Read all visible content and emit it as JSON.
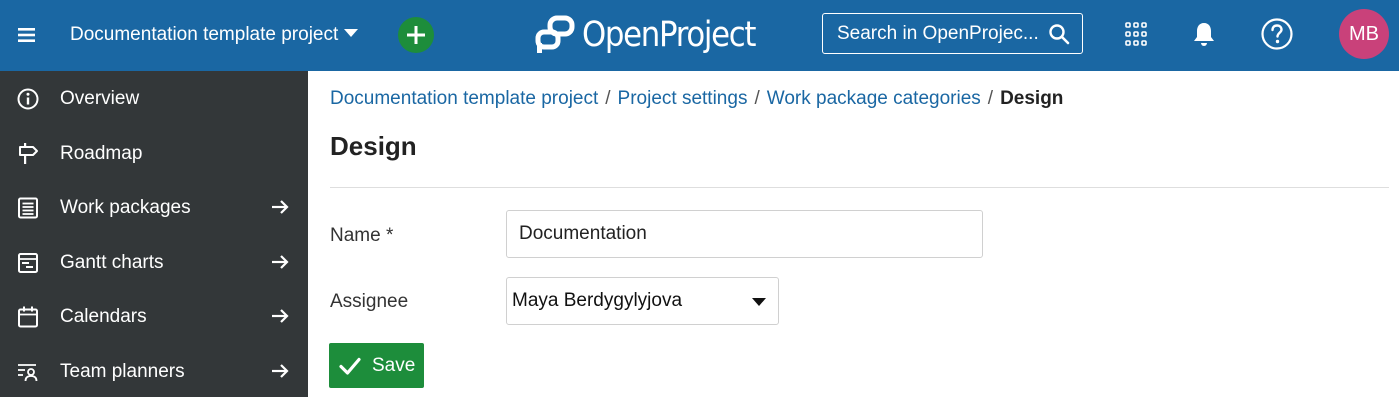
{
  "header": {
    "project_name": "Documentation template project",
    "logo_text": "OpenProject",
    "search_placeholder": "Search in OpenProjec...",
    "avatar_initials": "MB",
    "add_icon": "plus-icon",
    "grid_icon": "grid-icon",
    "bell_icon": "bell-icon",
    "help_icon": "help-icon"
  },
  "sidebar": {
    "items": [
      {
        "label": "Overview",
        "icon": "info-icon",
        "has_arrow": false
      },
      {
        "label": "Roadmap",
        "icon": "signpost-icon",
        "has_arrow": false
      },
      {
        "label": "Work packages",
        "icon": "list-icon",
        "has_arrow": true
      },
      {
        "label": "Gantt charts",
        "icon": "gantt-icon",
        "has_arrow": true
      },
      {
        "label": "Calendars",
        "icon": "calendar-icon",
        "has_arrow": true
      },
      {
        "label": "Team planners",
        "icon": "team-planner-icon",
        "has_arrow": true
      }
    ]
  },
  "breadcrumb": {
    "items": [
      "Documentation template project",
      "Project settings",
      "Work package categories"
    ],
    "current": "Design",
    "separator": "/"
  },
  "page": {
    "title": "Design"
  },
  "form": {
    "name_label": "Name *",
    "name_value": "Documentation",
    "assignee_label": "Assignee",
    "assignee_value": "Maya Berdygylyjova",
    "save_label": "Save"
  },
  "colors": {
    "header_bg": "#1a67a3",
    "sidebar_bg": "#333739",
    "link": "#1a67a3",
    "primary_button": "#1d8d3b",
    "avatar_bg": "#c9417a"
  }
}
